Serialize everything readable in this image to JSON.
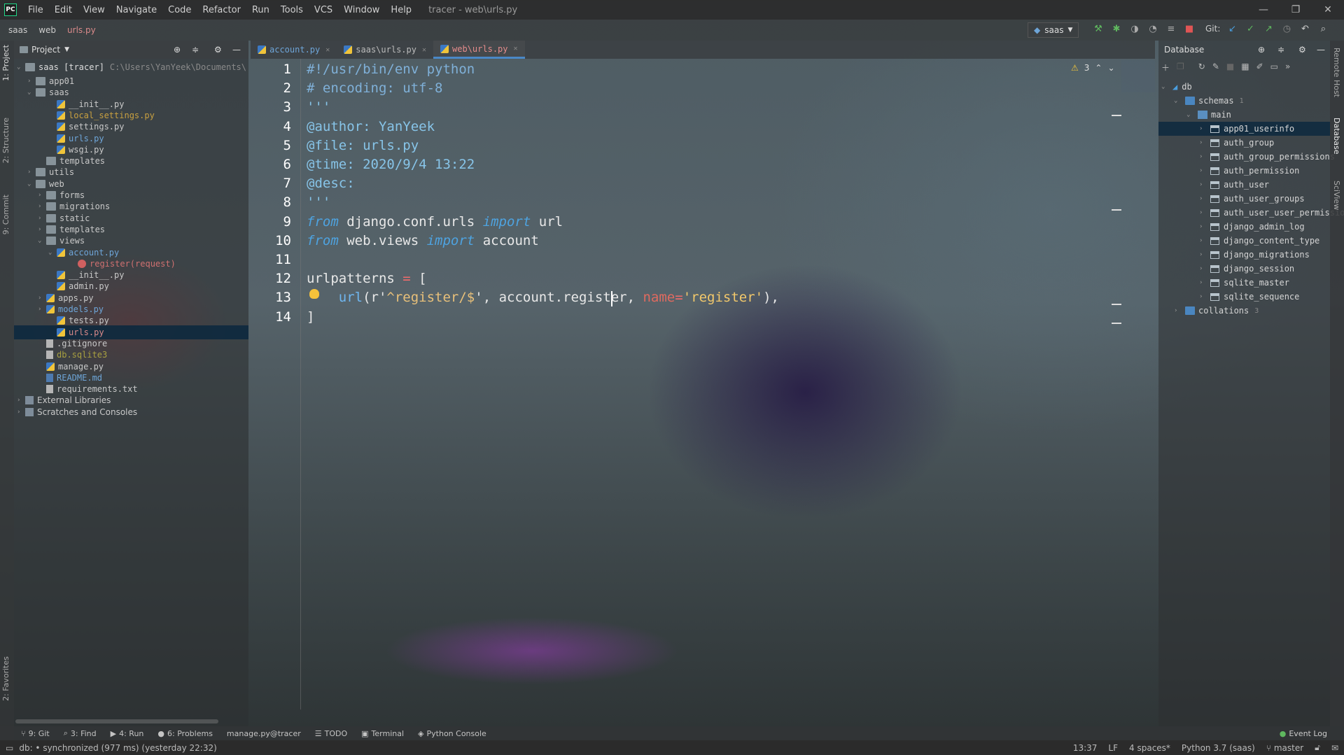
{
  "menu": {
    "logo": "PC",
    "items": [
      "File",
      "Edit",
      "View",
      "Navigate",
      "Code",
      "Refactor",
      "Run",
      "Tools",
      "VCS",
      "Window",
      "Help"
    ],
    "title": "tracer - web\\urls.py"
  },
  "window_controls": {
    "minimize": "—",
    "restore": "❐",
    "close": "✕"
  },
  "breadcrumb": [
    "saas",
    "web",
    "urls.py"
  ],
  "run_config": "saas",
  "git_label": "Git:",
  "project_panel": {
    "title": "Project",
    "root_label": "saas [tracer]",
    "root_path": "C:\\Users\\YanYeek\\Documents\\",
    "tree": [
      {
        "label": "app01",
        "indent": 1,
        "kind": "folder",
        "chev": "›"
      },
      {
        "label": "saas",
        "indent": 1,
        "kind": "folder",
        "chev": "⌄"
      },
      {
        "label": "__init__.py",
        "indent": 3,
        "kind": "py"
      },
      {
        "label": "local_settings.py",
        "indent": 3,
        "kind": "py",
        "color": "#c8a040"
      },
      {
        "label": "settings.py",
        "indent": 3,
        "kind": "py"
      },
      {
        "label": "urls.py",
        "indent": 3,
        "kind": "py",
        "color": "#6ea5d8"
      },
      {
        "label": "wsgi.py",
        "indent": 3,
        "kind": "py"
      },
      {
        "label": "templates",
        "indent": 2,
        "kind": "folder"
      },
      {
        "label": "utils",
        "indent": 1,
        "kind": "folder",
        "chev": "›"
      },
      {
        "label": "web",
        "indent": 1,
        "kind": "folder",
        "chev": "⌄"
      },
      {
        "label": "forms",
        "indent": 2,
        "kind": "folder",
        "chev": "›"
      },
      {
        "label": "migrations",
        "indent": 2,
        "kind": "folder",
        "chev": "›"
      },
      {
        "label": "static",
        "indent": 2,
        "kind": "folder",
        "chev": "›"
      },
      {
        "label": "templates",
        "indent": 2,
        "kind": "folder",
        "chev": "›"
      },
      {
        "label": "views",
        "indent": 2,
        "kind": "folder",
        "chev": "⌄"
      },
      {
        "label": "account.py",
        "indent": 3,
        "kind": "py",
        "chev": "⌄",
        "color": "#6ea5d8"
      },
      {
        "label": "register(request)",
        "indent": 5,
        "kind": "fn",
        "color": "#d07070"
      },
      {
        "label": "__init__.py",
        "indent": 3,
        "kind": "py"
      },
      {
        "label": "admin.py",
        "indent": 3,
        "kind": "py"
      },
      {
        "label": "apps.py",
        "indent": 2,
        "kind": "py",
        "chev": "›"
      },
      {
        "label": "models.py",
        "indent": 2,
        "kind": "py",
        "chev": "›",
        "color": "#6ea5d8"
      },
      {
        "label": "tests.py",
        "indent": 3,
        "kind": "py"
      },
      {
        "label": "urls.py",
        "indent": 3,
        "kind": "py",
        "color": "#d98a8a",
        "selected": true
      },
      {
        "label": ".gitignore",
        "indent": 2,
        "kind": "txt"
      },
      {
        "label": "db.sqlite3",
        "indent": 2,
        "kind": "txt",
        "color": "#a8a040"
      },
      {
        "label": "manage.py",
        "indent": 2,
        "kind": "py"
      },
      {
        "label": "README.md",
        "indent": 2,
        "kind": "md",
        "color": "#6ea5d8"
      },
      {
        "label": "requirements.txt",
        "indent": 2,
        "kind": "txt"
      },
      {
        "label": "External Libraries",
        "indent": 0,
        "kind": "lib",
        "chev": "›",
        "font": "sans"
      },
      {
        "label": "Scratches and Consoles",
        "indent": 0,
        "kind": "lib",
        "chev": "›",
        "font": "sans"
      }
    ]
  },
  "tabs": [
    {
      "label": "account.py",
      "active": false,
      "color": "#6ea5d8"
    },
    {
      "label": "saas\\urls.py",
      "active": false
    },
    {
      "label": "web\\urls.py",
      "active": true
    }
  ],
  "inspection": {
    "warnings": "3"
  },
  "editor": {
    "line_numbers": [
      "1",
      "2",
      "3",
      "4",
      "5",
      "6",
      "7",
      "8",
      "9",
      "10",
      "11",
      "12",
      "13",
      "14"
    ],
    "lines": [
      [
        {
          "t": "#!/usr/bin/env python",
          "c": "c-comment"
        }
      ],
      [
        {
          "t": "# encoding: utf-8",
          "c": "c-comment"
        }
      ],
      [
        {
          "t": "'''",
          "c": "c-doc"
        }
      ],
      [
        {
          "t": "@author: YanYeek",
          "c": "c-doc"
        }
      ],
      [
        {
          "t": "@file: urls.py",
          "c": "c-doc"
        }
      ],
      [
        {
          "t": "@time: 2020/9/4 13:22",
          "c": "c-doc"
        }
      ],
      [
        {
          "t": "@desc:",
          "c": "c-doc"
        }
      ],
      [
        {
          "t": "'''",
          "c": "c-doc"
        }
      ],
      [
        {
          "t": "from",
          "c": "c-kw"
        },
        {
          "t": " django.conf.urls ",
          "c": ""
        },
        {
          "t": "import",
          "c": "c-kw"
        },
        {
          "t": " url",
          "c": ""
        }
      ],
      [
        {
          "t": "from",
          "c": "c-kw"
        },
        {
          "t": " web.views ",
          "c": ""
        },
        {
          "t": "import",
          "c": "c-kw"
        },
        {
          "t": " account",
          "c": ""
        }
      ],
      [],
      [
        {
          "t": "urlpatterns ",
          "c": ""
        },
        {
          "t": "=",
          "c": "c-op"
        },
        {
          "t": " [",
          "c": ""
        }
      ],
      [
        {
          "t": "    ",
          "c": ""
        },
        {
          "t": "url",
          "c": "c-fn"
        },
        {
          "t": "(r'",
          "c": ""
        },
        {
          "t": "^register/$",
          "c": "c-strp"
        },
        {
          "t": "', account.register, ",
          "c": ""
        },
        {
          "t": "name",
          "c": "c-name"
        },
        {
          "t": "=",
          "c": "c-op"
        },
        {
          "t": "'register'",
          "c": "c-str"
        },
        {
          "t": "),",
          "c": ""
        }
      ],
      [
        {
          "t": "]",
          "c": ""
        }
      ]
    ]
  },
  "database_panel": {
    "title": "Database",
    "tree": [
      {
        "label": "db",
        "indent": 0,
        "chev": "⌄",
        "kind": "db"
      },
      {
        "label": "schemas",
        "indent": 1,
        "chev": "⌄",
        "kind": "folder",
        "count": "1"
      },
      {
        "label": "main",
        "indent": 2,
        "chev": "⌄",
        "kind": "schema"
      },
      {
        "label": "app01_userinfo",
        "indent": 3,
        "chev": "›",
        "kind": "table",
        "selected": true
      },
      {
        "label": "auth_group",
        "indent": 3,
        "chev": "›",
        "kind": "table"
      },
      {
        "label": "auth_group_permissions",
        "indent": 3,
        "chev": "›",
        "kind": "table"
      },
      {
        "label": "auth_permission",
        "indent": 3,
        "chev": "›",
        "kind": "table"
      },
      {
        "label": "auth_user",
        "indent": 3,
        "chev": "›",
        "kind": "table"
      },
      {
        "label": "auth_user_groups",
        "indent": 3,
        "chev": "›",
        "kind": "table"
      },
      {
        "label": "auth_user_user_permissions",
        "indent": 3,
        "chev": "›",
        "kind": "table"
      },
      {
        "label": "django_admin_log",
        "indent": 3,
        "chev": "›",
        "kind": "table"
      },
      {
        "label": "django_content_type",
        "indent": 3,
        "chev": "›",
        "kind": "table"
      },
      {
        "label": "django_migrations",
        "indent": 3,
        "chev": "›",
        "kind": "table"
      },
      {
        "label": "django_session",
        "indent": 3,
        "chev": "›",
        "kind": "table"
      },
      {
        "label": "sqlite_master",
        "indent": 3,
        "chev": "›",
        "kind": "table"
      },
      {
        "label": "sqlite_sequence",
        "indent": 3,
        "chev": "›",
        "kind": "table"
      },
      {
        "label": "collations",
        "indent": 1,
        "chev": "›",
        "kind": "folder",
        "count": "3"
      }
    ]
  },
  "left_stripe": [
    "1: Project",
    "2: Structure",
    "9: Commit",
    "2: Favorites"
  ],
  "right_stripe": [
    "Remote Host",
    "Database",
    "SciView"
  ],
  "tool_windows": [
    {
      "label": "9: Git",
      "icon": "⑂"
    },
    {
      "label": "3: Find",
      "icon": "⌕"
    },
    {
      "label": "4: Run",
      "icon": "▶"
    },
    {
      "label": "6: Problems",
      "icon": "●"
    },
    {
      "label": "manage.py@tracer",
      "icon": ""
    },
    {
      "label": "TODO",
      "icon": "☰"
    },
    {
      "label": "Terminal",
      "icon": "▣"
    },
    {
      "label": "Python Console",
      "icon": "◈"
    }
  ],
  "event_log": "Event Log",
  "status": {
    "message": "db: • synchronized (977 ms) (yesterday 22:32)",
    "position": "13:37",
    "line_sep": "LF",
    "indent": "4 spaces*",
    "interpreter": "Python 3.7 (saas)",
    "branch": "master"
  },
  "colors": {
    "accent": "#4a88c7",
    "selection": "#0d293e",
    "warning": "#f0c43a"
  }
}
